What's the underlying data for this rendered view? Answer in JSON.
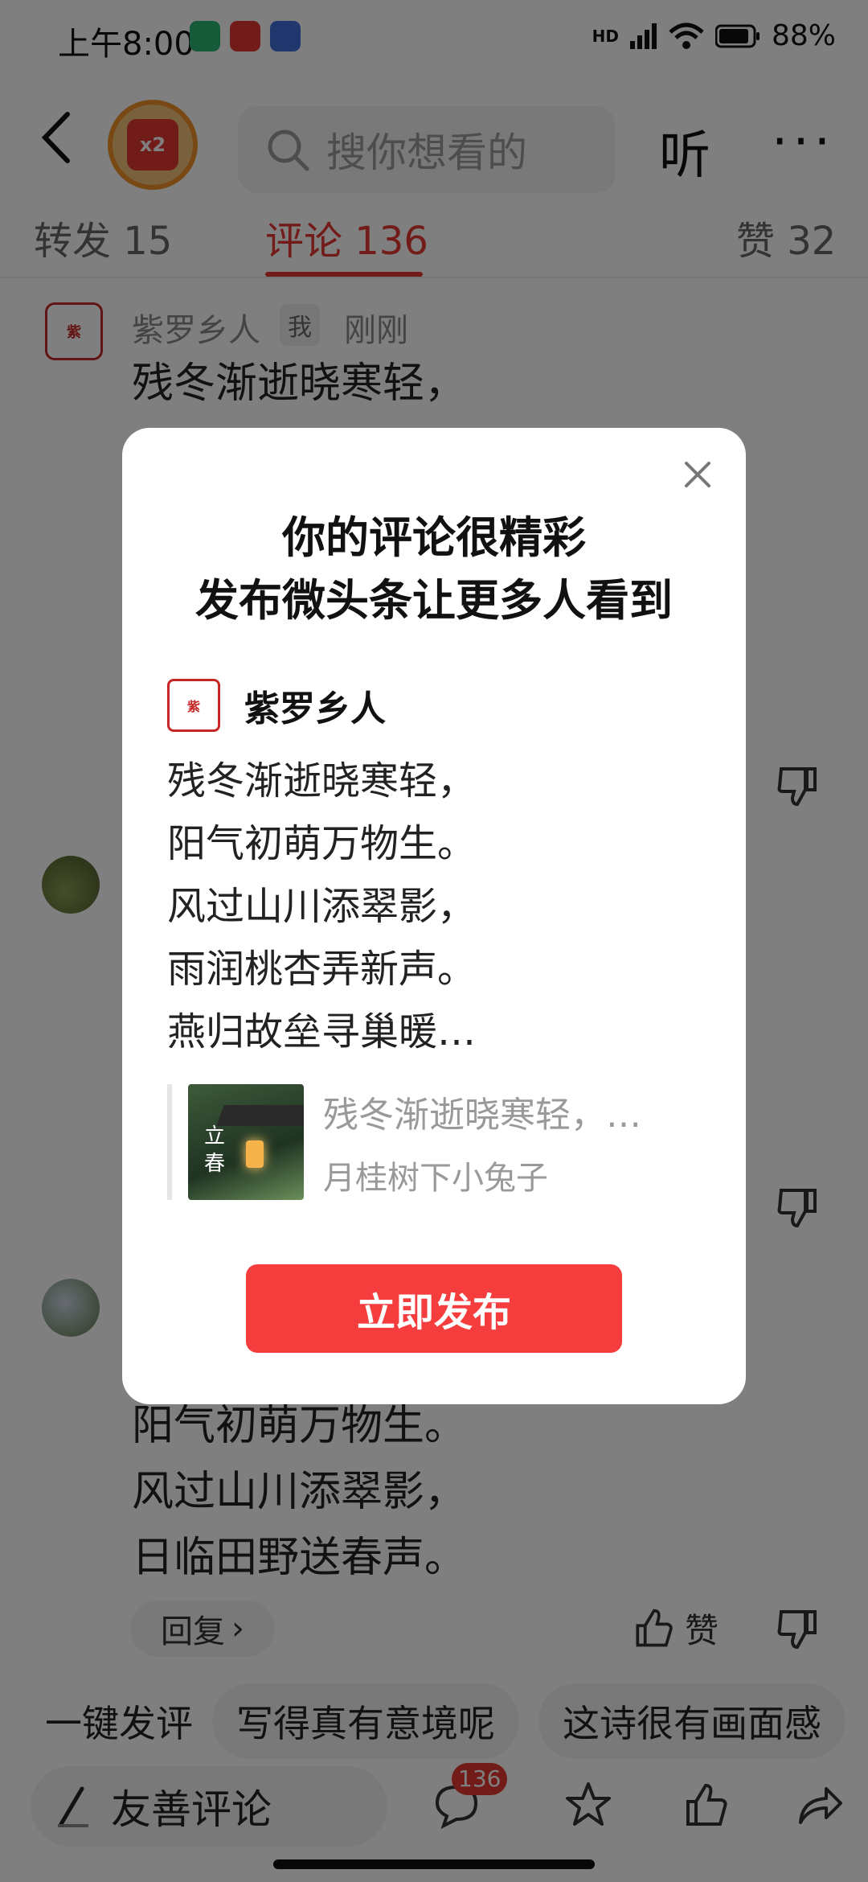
{
  "status_bar": {
    "time": "上午8:00",
    "battery": "88%",
    "network": "HD"
  },
  "header": {
    "badge_text": "x2",
    "search_placeholder": "搜你想看的",
    "listen": "听",
    "more": "···"
  },
  "tabs": [
    {
      "label": "转发 15"
    },
    {
      "label": "评论 136"
    },
    {
      "label": "赞 32"
    }
  ],
  "comments": {
    "first": {
      "author": "紫罗乡人",
      "tag": "我",
      "time": "刚刚",
      "line1": "残冬渐逝晓寒轻，"
    },
    "visible_lines": [
      "阳气初萌万物生。",
      "风过山川添翠影，",
      "日临田野送春声。"
    ],
    "reply": "回复",
    "like": "赞"
  },
  "quick_comments": {
    "lead": "一键发评",
    "chips": [
      "写得真有意境呢",
      "这诗很有画面感"
    ]
  },
  "bottom_bar": {
    "write": "友善评论",
    "comment_count": "136"
  },
  "modal": {
    "title_line1": "你的评论很精彩",
    "title_line2": "发布微头条让更多人看到",
    "author": "紫罗乡人",
    "poem_lines": [
      "残冬渐逝晓寒轻，",
      "阳气初萌万物生。",
      "风过山川添翠影，",
      "雨润桃杏弄新声。",
      "燕归故垒寻巢暖…"
    ],
    "quote_text": "残冬渐逝晓寒轻，…",
    "quote_author": "月桂树下小兔子",
    "thumb_text": "立春",
    "publish": "立即发布"
  },
  "colors": {
    "accent": "#e53935",
    "publish_button": "#f53d3d"
  }
}
